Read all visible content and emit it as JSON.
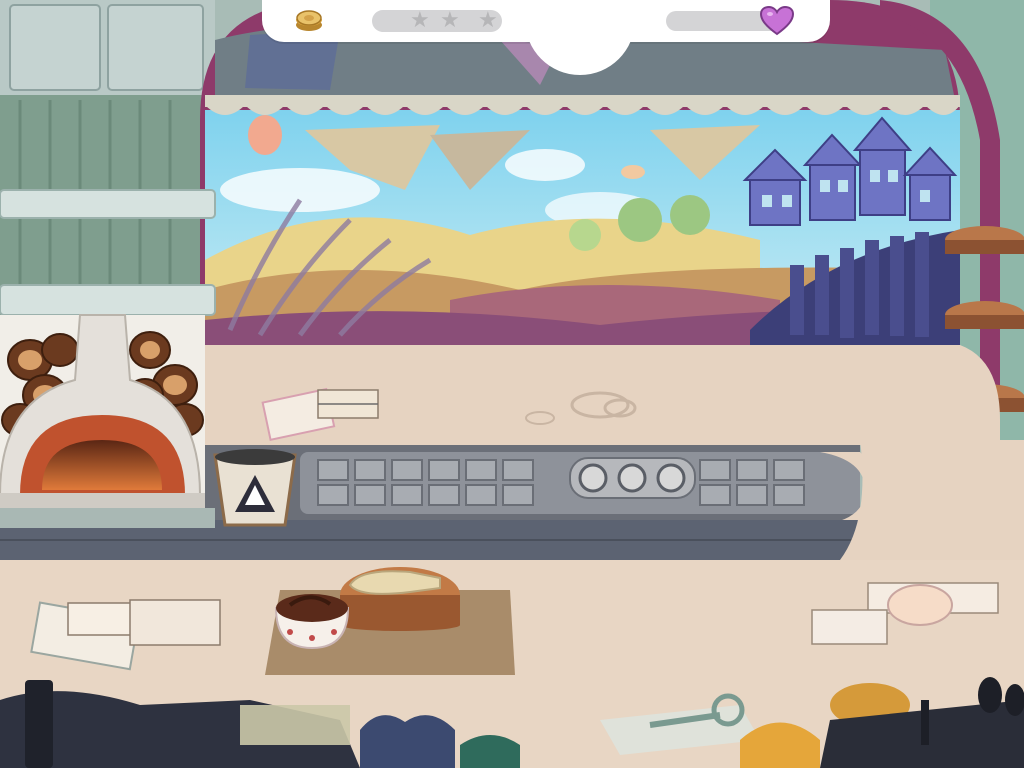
{
  "hud": {
    "coin_icon": "coin-stack-icon",
    "star_rating": {
      "earned": 0,
      "total": 3
    },
    "star_glyph": "★",
    "customer_love_icon": "heart-icon",
    "customer_love_level": 0
  },
  "scene": {
    "description_icons": [
      "pizza-oven",
      "recycle-bin",
      "chopping-board",
      "chocolate-bowl",
      "recipe-notes",
      "key"
    ],
    "colors": {
      "counter": "#e8d6c4",
      "wall": "#9fb7ac",
      "sky": "#8fd4ee",
      "brick": "#c0522e",
      "heart": "#c772d6",
      "coin": "#e0b048"
    }
  }
}
